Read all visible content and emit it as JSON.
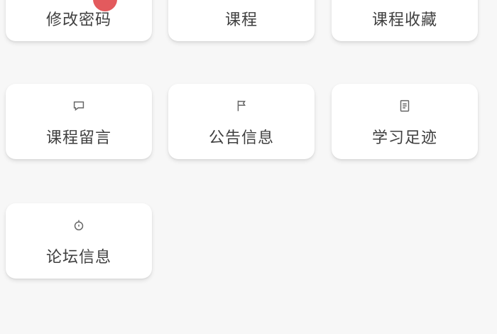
{
  "grid": {
    "items": [
      {
        "label": "修改密码",
        "icon": "edit-icon"
      },
      {
        "label": "课程",
        "icon": "book-icon"
      },
      {
        "label": "课程收藏",
        "icon": "star-icon"
      },
      {
        "label": "课程留言",
        "icon": "message-icon"
      },
      {
        "label": "公告信息",
        "icon": "flag-icon"
      },
      {
        "label": "学习足迹",
        "icon": "document-icon"
      },
      {
        "label": "论坛信息",
        "icon": "bulb-icon"
      }
    ]
  },
  "colors": {
    "badge": "#e0484b",
    "card_bg": "#ffffff",
    "page_bg": "#f7f7f7"
  }
}
